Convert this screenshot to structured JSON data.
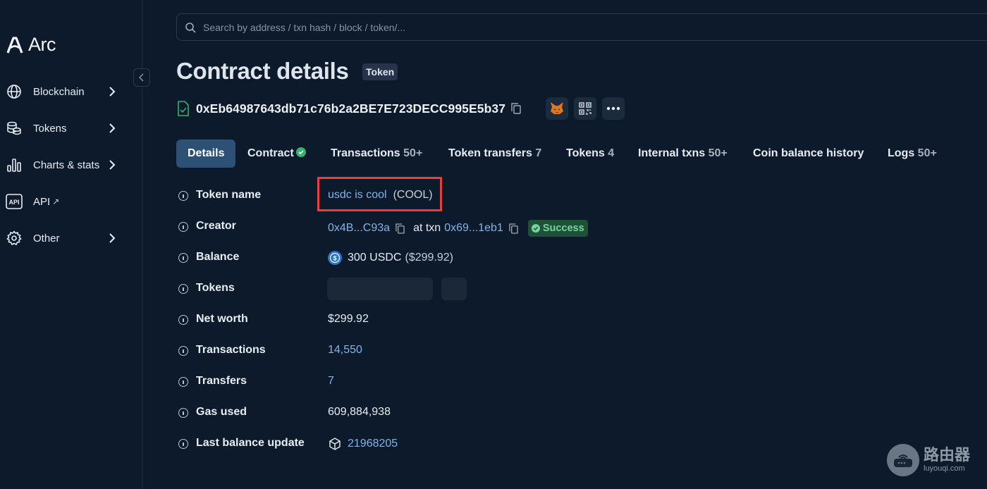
{
  "app": {
    "name": "Arc"
  },
  "sidebar": {
    "items": [
      {
        "label": "Blockchain",
        "icon": "globe-icon",
        "has_chevron": true
      },
      {
        "label": "Tokens",
        "icon": "coins-icon",
        "has_chevron": true
      },
      {
        "label": "Charts & stats",
        "icon": "bar-chart-icon",
        "has_chevron": true
      },
      {
        "label": "API",
        "icon": "api-icon",
        "external": "↗"
      },
      {
        "label": "Other",
        "icon": "gear-icon",
        "has_chevron": true
      }
    ]
  },
  "search": {
    "placeholder": "Search by address / txn hash / block / token/..."
  },
  "page": {
    "title": "Contract details",
    "tag": "Token",
    "address": "0xEb64987643db71c76b2a2BE7E723DECC995E5b37"
  },
  "tabs": [
    {
      "label": "Details",
      "count": "",
      "active": true
    },
    {
      "label": "Contract",
      "count": "",
      "verified": true
    },
    {
      "label": "Transactions",
      "count": "50+"
    },
    {
      "label": "Token transfers",
      "count": "7"
    },
    {
      "label": "Tokens",
      "count": "4"
    },
    {
      "label": "Internal txns",
      "count": "50+"
    },
    {
      "label": "Coin balance history",
      "count": ""
    },
    {
      "label": "Logs",
      "count": "50+"
    }
  ],
  "details": {
    "token_name": {
      "label": "Token name",
      "name": "usdc is cool",
      "symbol": "(COOL)"
    },
    "creator": {
      "label": "Creator",
      "address": "0x4B...C93a",
      "at_txn": "at txn",
      "txn": "0x69...1eb1",
      "status": "Success"
    },
    "balance": {
      "label": "Balance",
      "value": "300 USDC",
      "usd": "($299.92)"
    },
    "tokens": {
      "label": "Tokens"
    },
    "net_worth": {
      "label": "Net worth",
      "value": "$299.92"
    },
    "transactions": {
      "label": "Transactions",
      "value": "14,550"
    },
    "transfers": {
      "label": "Transfers",
      "value": "7"
    },
    "gas_used": {
      "label": "Gas used",
      "value": "609,884,938"
    },
    "last_balance_update": {
      "label": "Last balance update",
      "value": "21968205"
    }
  },
  "watermark": {
    "title": "路由器",
    "url": "luyouqi.com"
  },
  "colors": {
    "background": "#0c1a2b",
    "link": "#82b4e6",
    "active_tab": "#2d5175",
    "success": "#70d69c",
    "highlight": "#e53f3f"
  }
}
